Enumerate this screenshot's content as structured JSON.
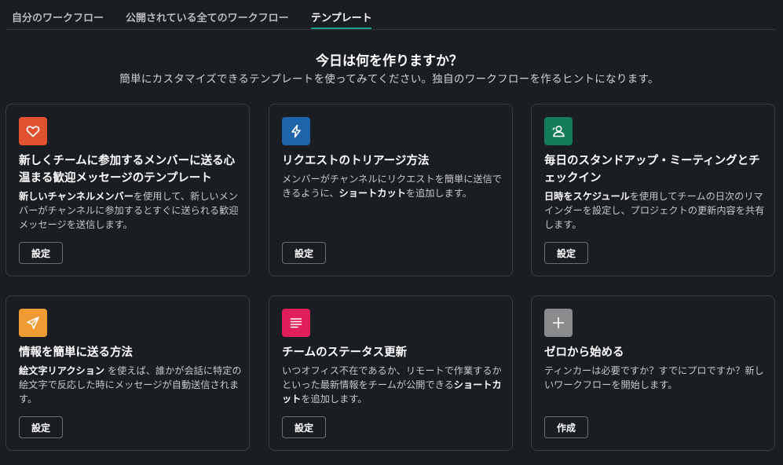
{
  "tabs": [
    {
      "label": "自分のワークフロー"
    },
    {
      "label": "公開されている全てのワークフロー"
    },
    {
      "label": "テンプレート",
      "active": true
    }
  ],
  "hero": {
    "title": "今日は何を作りますか？",
    "subtitle": "簡単にカスタマイズできるテンプレートを使ってみてください。独自のワークフローを作るヒントになります。"
  },
  "cards": [
    {
      "icon": "heart-icon",
      "icon_color": "#e0522f",
      "title": "新しくチームに参加するメンバーに送る心温まる歓迎メッセージのテンプレート",
      "desc_bold_1": "新しいチャンネルメンバー",
      "desc_text_1": "を使用して、新しいメンバーがチャンネルに参加するとすぐに送られる歓迎メッセージを送信します。",
      "button": "設定"
    },
    {
      "icon": "lightning-icon",
      "icon_color": "#1d64a8",
      "title": "リクエストのトリアージ方法",
      "desc_text_1": "メンバーがチャンネルにリクエストを簡単に送信できるように、",
      "desc_bold_1": "ショートカット",
      "desc_text_2": "を追加します。",
      "button": "設定"
    },
    {
      "icon": "person-icon",
      "icon_color": "#137a5a",
      "title": "毎日のスタンドアップ・ミーティングとチェックイン",
      "desc_bold_1": "日時をスケジュール",
      "desc_text_1": "を使用してチームの日次のリマインダーを設定し、プロジェクトの更新内容を共有します。",
      "button": "設定"
    },
    {
      "icon": "paper-plane-icon",
      "icon_color": "#f09a33",
      "title": "情報を簡単に送る方法",
      "desc_bold_1": "絵文字リアクション",
      "desc_text_1": " を使えば、誰かが会話に特定の絵文字で反応した時にメッセージが自動送信されます。",
      "button": "設定"
    },
    {
      "icon": "list-icon",
      "icon_color": "#e01e5a",
      "title": "チームのステータス更新",
      "desc_text_1": "いつオフィス不在であるか、リモートで作業するかといった最新情報をチームが公開できる",
      "desc_bold_1": "ショートカット",
      "desc_text_2": "を追加します。",
      "button": "設定"
    },
    {
      "icon": "plus-icon",
      "icon_color": "#8a8b8d",
      "title": "ゼロから始める",
      "desc_text_1": "ティンカーは必要ですか？すでにプロですか？新しいワークフローを開始します。",
      "button": "作成"
    }
  ]
}
